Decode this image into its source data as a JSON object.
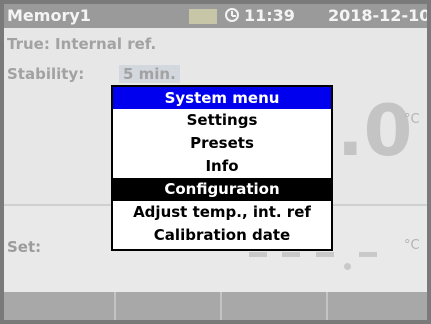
{
  "status_bar": {
    "title": "Memory1",
    "time": "11:39",
    "date": "2018-12-10",
    "icons": [
      "battery-icon",
      "clock-icon"
    ]
  },
  "readings": {
    "true_line": "True: Internal ref.",
    "stability_label": "Stability:",
    "stability_value": "5 min.",
    "big_value_partial": ".0",
    "unit": "°C",
    "set_label": "Set:"
  },
  "menu": {
    "title": "System menu",
    "items": [
      "Settings",
      "Presets",
      "Info",
      "Configuration",
      "Adjust temp., int. ref",
      "Calibration date"
    ],
    "selected": "Configuration"
  },
  "softkeys": [
    "",
    "",
    "",
    ""
  ],
  "colors": {
    "menu_title_bg": "#0000ee",
    "selected_bg": "#000000"
  }
}
